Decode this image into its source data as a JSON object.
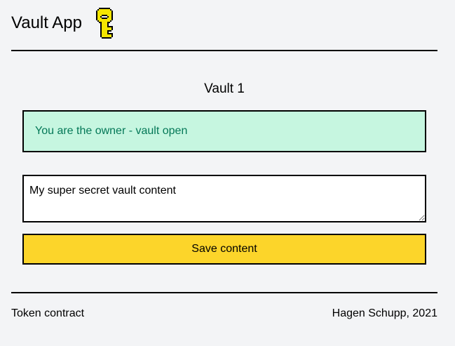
{
  "header": {
    "app_title": "Vault App",
    "logo_icon": "key-icon",
    "key_color": "#f5e600"
  },
  "vault": {
    "title": "Vault 1",
    "status_text": "You are the owner - vault open",
    "status_bg": "#c6f6e0",
    "status_fg": "#047857",
    "content_value": "My super secret vault content",
    "save_label": "Save content",
    "save_bg": "#fcd52a"
  },
  "footer": {
    "token_link": "Token contract",
    "credit": "Hagen Schupp, 2021"
  }
}
